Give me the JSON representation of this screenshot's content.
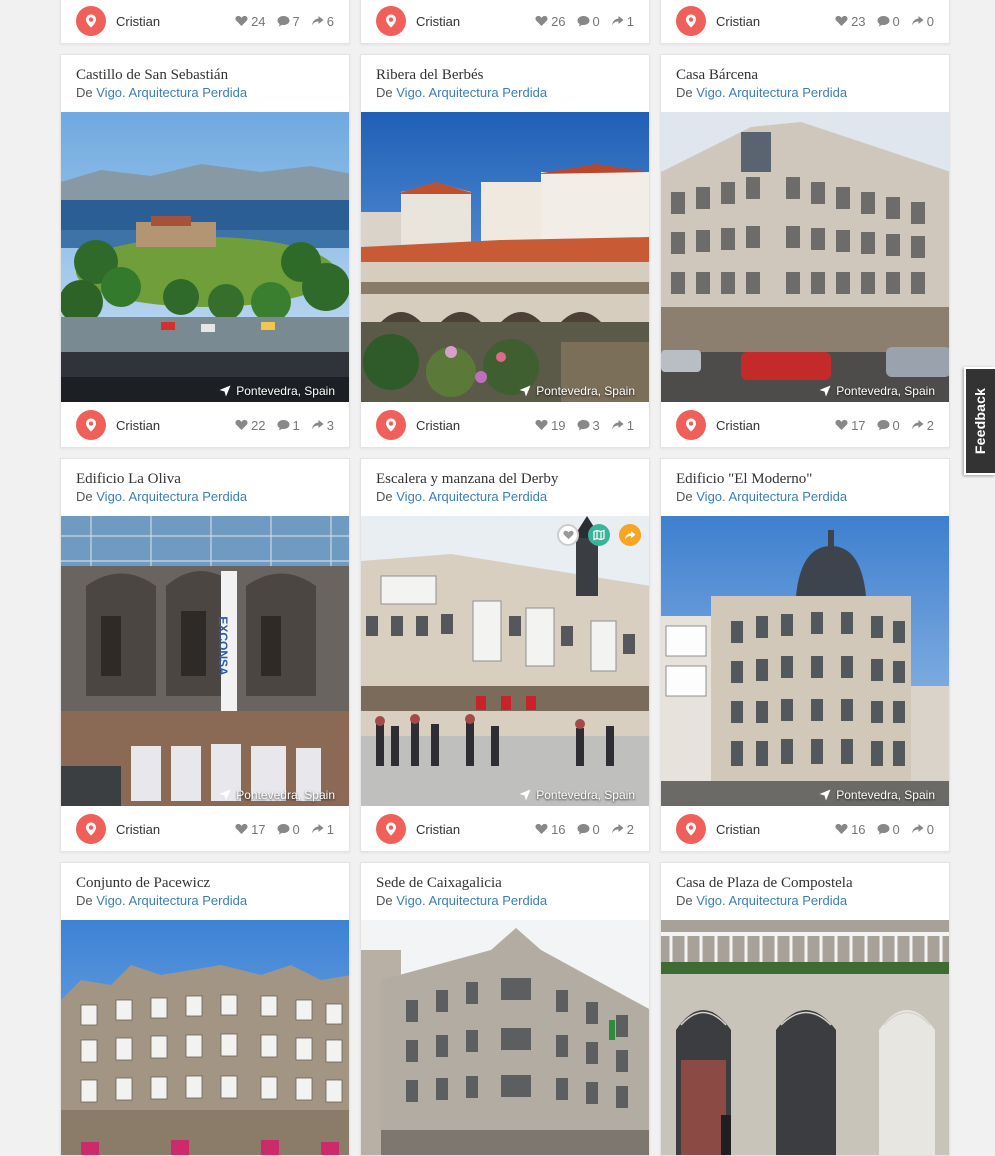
{
  "top_row": [
    {
      "user": "Cristian",
      "likes": "24",
      "comments": "7",
      "shares": "6"
    },
    {
      "user": "Cristian",
      "likes": "26",
      "comments": "0",
      "shares": "1"
    },
    {
      "user": "Cristian",
      "likes": "23",
      "comments": "0",
      "shares": "0"
    }
  ],
  "cards": [
    {
      "title": "Castillo de San Sebastián",
      "source_prefix": "De",
      "source": "Vigo. Arquitectura Perdida",
      "location": "Pontevedra, Spain",
      "user": "Cristian",
      "likes": "22",
      "comments": "1",
      "shares": "3",
      "scene": "castle"
    },
    {
      "title": "Ribera del Berbés",
      "source_prefix": "De",
      "source": "Vigo. Arquitectura Perdida",
      "location": "Pontevedra, Spain",
      "user": "Cristian",
      "likes": "19",
      "comments": "3",
      "shares": "1",
      "scene": "berbes"
    },
    {
      "title": "Casa Bárcena",
      "source_prefix": "De",
      "source": "Vigo. Arquitectura Perdida",
      "location": "Pontevedra, Spain",
      "user": "Cristian",
      "likes": "17",
      "comments": "0",
      "shares": "2",
      "scene": "barcena"
    },
    {
      "title": "Edificio La Oliva",
      "source_prefix": "De",
      "source": "Vigo. Arquitectura Perdida",
      "location": "Pontevedra, Spain",
      "user": "Cristian",
      "likes": "17",
      "comments": "0",
      "shares": "1",
      "scene": "oliva"
    },
    {
      "title": "Escalera y manzana del Derby",
      "source_prefix": "De",
      "source": "Vigo. Arquitectura Perdida",
      "location": "Pontevedra, Spain",
      "user": "Cristian",
      "likes": "16",
      "comments": "0",
      "shares": "2",
      "scene": "derby"
    },
    {
      "title": "Edificio \"El Moderno\"",
      "source_prefix": "De",
      "source": "Vigo. Arquitectura Perdida",
      "location": "Pontevedra, Spain",
      "user": "Cristian",
      "likes": "16",
      "comments": "0",
      "shares": "0",
      "scene": "moderno"
    },
    {
      "title": "Conjunto de Pacewicz",
      "source_prefix": "De",
      "source": "Vigo. Arquitectura Perdida",
      "scene": "pacewicz"
    },
    {
      "title": "Sede de Caixagalicia",
      "source_prefix": "De",
      "source": "Vigo. Arquitectura Perdida",
      "scene": "caixa"
    },
    {
      "title": "Casa de Plaza de Compostela",
      "source_prefix": "De",
      "source": "Vigo. Arquitectura Perdida",
      "scene": "compostela"
    }
  ],
  "hover_actions": [
    "heart-icon",
    "map-icon",
    "share-icon"
  ],
  "feedback_label": "Feedback",
  "colors": {
    "link": "#3b7fb5",
    "avatar": "#f0605a",
    "share_action": "#f6a623",
    "map_action": "#3bb39b"
  }
}
